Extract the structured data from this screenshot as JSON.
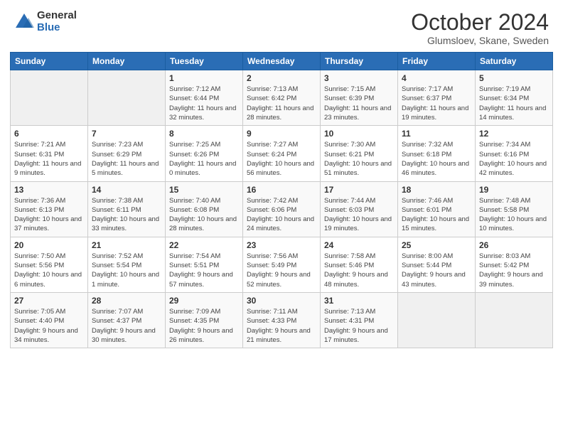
{
  "header": {
    "logo_general": "General",
    "logo_blue": "Blue",
    "month": "October 2024",
    "location": "Glumsloev, Skane, Sweden"
  },
  "days_of_week": [
    "Sunday",
    "Monday",
    "Tuesday",
    "Wednesday",
    "Thursday",
    "Friday",
    "Saturday"
  ],
  "weeks": [
    [
      {
        "day": "",
        "info": ""
      },
      {
        "day": "",
        "info": ""
      },
      {
        "day": "1",
        "info": "Sunrise: 7:12 AM\nSunset: 6:44 PM\nDaylight: 11 hours and 32 minutes."
      },
      {
        "day": "2",
        "info": "Sunrise: 7:13 AM\nSunset: 6:42 PM\nDaylight: 11 hours and 28 minutes."
      },
      {
        "day": "3",
        "info": "Sunrise: 7:15 AM\nSunset: 6:39 PM\nDaylight: 11 hours and 23 minutes."
      },
      {
        "day": "4",
        "info": "Sunrise: 7:17 AM\nSunset: 6:37 PM\nDaylight: 11 hours and 19 minutes."
      },
      {
        "day": "5",
        "info": "Sunrise: 7:19 AM\nSunset: 6:34 PM\nDaylight: 11 hours and 14 minutes."
      }
    ],
    [
      {
        "day": "6",
        "info": "Sunrise: 7:21 AM\nSunset: 6:31 PM\nDaylight: 11 hours and 9 minutes."
      },
      {
        "day": "7",
        "info": "Sunrise: 7:23 AM\nSunset: 6:29 PM\nDaylight: 11 hours and 5 minutes."
      },
      {
        "day": "8",
        "info": "Sunrise: 7:25 AM\nSunset: 6:26 PM\nDaylight: 11 hours and 0 minutes."
      },
      {
        "day": "9",
        "info": "Sunrise: 7:27 AM\nSunset: 6:24 PM\nDaylight: 10 hours and 56 minutes."
      },
      {
        "day": "10",
        "info": "Sunrise: 7:30 AM\nSunset: 6:21 PM\nDaylight: 10 hours and 51 minutes."
      },
      {
        "day": "11",
        "info": "Sunrise: 7:32 AM\nSunset: 6:18 PM\nDaylight: 10 hours and 46 minutes."
      },
      {
        "day": "12",
        "info": "Sunrise: 7:34 AM\nSunset: 6:16 PM\nDaylight: 10 hours and 42 minutes."
      }
    ],
    [
      {
        "day": "13",
        "info": "Sunrise: 7:36 AM\nSunset: 6:13 PM\nDaylight: 10 hours and 37 minutes."
      },
      {
        "day": "14",
        "info": "Sunrise: 7:38 AM\nSunset: 6:11 PM\nDaylight: 10 hours and 33 minutes."
      },
      {
        "day": "15",
        "info": "Sunrise: 7:40 AM\nSunset: 6:08 PM\nDaylight: 10 hours and 28 minutes."
      },
      {
        "day": "16",
        "info": "Sunrise: 7:42 AM\nSunset: 6:06 PM\nDaylight: 10 hours and 24 minutes."
      },
      {
        "day": "17",
        "info": "Sunrise: 7:44 AM\nSunset: 6:03 PM\nDaylight: 10 hours and 19 minutes."
      },
      {
        "day": "18",
        "info": "Sunrise: 7:46 AM\nSunset: 6:01 PM\nDaylight: 10 hours and 15 minutes."
      },
      {
        "day": "19",
        "info": "Sunrise: 7:48 AM\nSunset: 5:58 PM\nDaylight: 10 hours and 10 minutes."
      }
    ],
    [
      {
        "day": "20",
        "info": "Sunrise: 7:50 AM\nSunset: 5:56 PM\nDaylight: 10 hours and 6 minutes."
      },
      {
        "day": "21",
        "info": "Sunrise: 7:52 AM\nSunset: 5:54 PM\nDaylight: 10 hours and 1 minute."
      },
      {
        "day": "22",
        "info": "Sunrise: 7:54 AM\nSunset: 5:51 PM\nDaylight: 9 hours and 57 minutes."
      },
      {
        "day": "23",
        "info": "Sunrise: 7:56 AM\nSunset: 5:49 PM\nDaylight: 9 hours and 52 minutes."
      },
      {
        "day": "24",
        "info": "Sunrise: 7:58 AM\nSunset: 5:46 PM\nDaylight: 9 hours and 48 minutes."
      },
      {
        "day": "25",
        "info": "Sunrise: 8:00 AM\nSunset: 5:44 PM\nDaylight: 9 hours and 43 minutes."
      },
      {
        "day": "26",
        "info": "Sunrise: 8:03 AM\nSunset: 5:42 PM\nDaylight: 9 hours and 39 minutes."
      }
    ],
    [
      {
        "day": "27",
        "info": "Sunrise: 7:05 AM\nSunset: 4:40 PM\nDaylight: 9 hours and 34 minutes."
      },
      {
        "day": "28",
        "info": "Sunrise: 7:07 AM\nSunset: 4:37 PM\nDaylight: 9 hours and 30 minutes."
      },
      {
        "day": "29",
        "info": "Sunrise: 7:09 AM\nSunset: 4:35 PM\nDaylight: 9 hours and 26 minutes."
      },
      {
        "day": "30",
        "info": "Sunrise: 7:11 AM\nSunset: 4:33 PM\nDaylight: 9 hours and 21 minutes."
      },
      {
        "day": "31",
        "info": "Sunrise: 7:13 AM\nSunset: 4:31 PM\nDaylight: 9 hours and 17 minutes."
      },
      {
        "day": "",
        "info": ""
      },
      {
        "day": "",
        "info": ""
      }
    ]
  ]
}
